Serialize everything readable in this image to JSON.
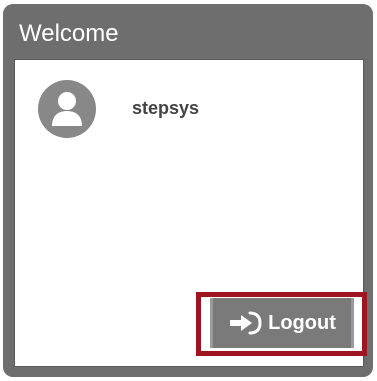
{
  "panel": {
    "title": "Welcome"
  },
  "user": {
    "name": "stepsys",
    "avatar_icon": "user-avatar-icon"
  },
  "actions": {
    "logout_label": "Logout",
    "logout_icon": "sign-in-arrow-icon"
  },
  "colors": {
    "panel_frame": "#6e6e6e",
    "button_bg": "#7a7a7a",
    "highlight": "#9e1520"
  }
}
